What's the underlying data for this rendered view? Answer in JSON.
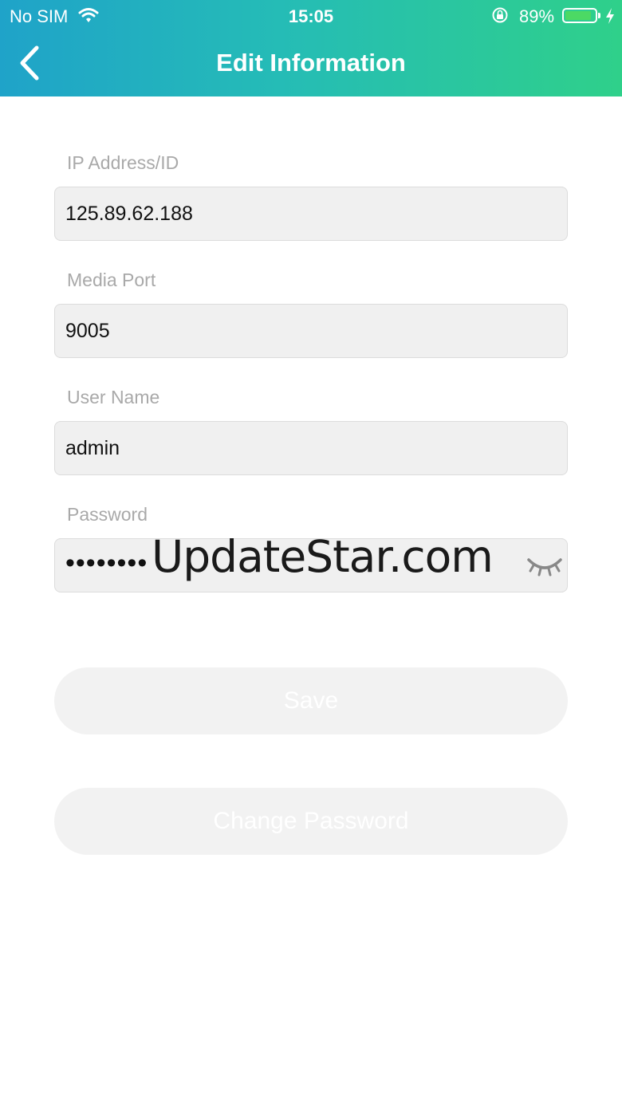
{
  "status_bar": {
    "carrier": "No SIM",
    "time": "15:05",
    "battery_percent": "89%",
    "battery_level": 0.89,
    "icons": [
      "wifi-icon",
      "orientation-lock-icon",
      "battery-icon",
      "charging-bolt-icon"
    ]
  },
  "header": {
    "title": "Edit Information",
    "back_icon": "chevron-left-icon"
  },
  "form": {
    "ip": {
      "label": "IP Address/ID",
      "value": "125.89.62.188"
    },
    "media_port": {
      "label": "Media Port",
      "value": "9005"
    },
    "username": {
      "label": "User Name",
      "value": "admin"
    },
    "password": {
      "label": "Password",
      "value": "••••••••",
      "toggle_icon": "eye-closed-icon"
    }
  },
  "buttons": {
    "save": "Save",
    "change_password": "Change Password"
  },
  "watermark": "UpdateStar.com",
  "colors": {
    "header_gradient_start": "#1fa3c9",
    "header_gradient_end": "#2fd08a",
    "input_background": "#f0f0f0",
    "label_text": "#a9a9a9",
    "button_background": "#f2f2f2"
  }
}
